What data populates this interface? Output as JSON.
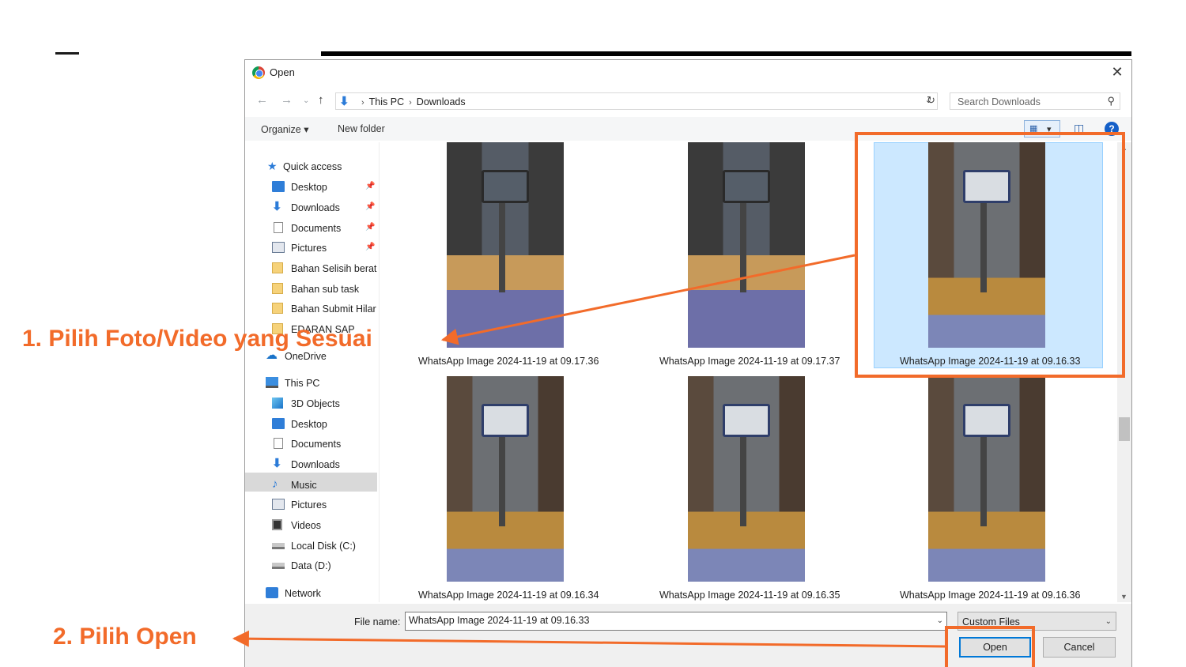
{
  "dialog": {
    "title": "Open",
    "close_symbol": "✕",
    "address": {
      "crumbs": [
        "This PC",
        "Downloads"
      ]
    },
    "search_placeholder": "Search Downloads",
    "toolbar": {
      "organize": "Organize ▾",
      "new_folder": "New folder",
      "help": "?"
    }
  },
  "sidebar": {
    "items": [
      {
        "label": "Quick access",
        "icon": "star-icon"
      },
      {
        "label": "Desktop",
        "icon": "desktop-folder-icon",
        "pinned": true
      },
      {
        "label": "Downloads",
        "icon": "download-arrow-icon",
        "pinned": true
      },
      {
        "label": "Documents",
        "icon": "document-icon",
        "pinned": true
      },
      {
        "label": "Pictures",
        "icon": "pictures-icon",
        "pinned": true
      },
      {
        "label": "Bahan Selisih berat",
        "icon": "folder-icon"
      },
      {
        "label": "Bahan sub task",
        "icon": "folder-icon"
      },
      {
        "label": "Bahan Submit Hilar",
        "icon": "folder-icon"
      },
      {
        "label": "EDARAN SAP",
        "icon": "folder-icon"
      },
      {
        "label": "OneDrive",
        "icon": "cloud-icon"
      },
      {
        "label": "This PC",
        "icon": "computer-icon"
      },
      {
        "label": "3D Objects",
        "icon": "cube-icon"
      },
      {
        "label": "Desktop",
        "icon": "desktop-folder-icon"
      },
      {
        "label": "Documents",
        "icon": "document-icon"
      },
      {
        "label": "Downloads",
        "icon": "download-arrow-icon",
        "selected": true
      },
      {
        "label": "Music",
        "icon": "music-note-icon"
      },
      {
        "label": "Pictures",
        "icon": "pictures-icon"
      },
      {
        "label": "Videos",
        "icon": "video-icon"
      },
      {
        "label": "Local Disk (C:)",
        "icon": "disk-icon"
      },
      {
        "label": "Data (D:)",
        "icon": "disk-icon"
      },
      {
        "label": "Network",
        "icon": "network-icon"
      }
    ]
  },
  "files": [
    {
      "name": "WhatsApp Image 2024-11-19 at 09.17.36"
    },
    {
      "name": "WhatsApp Image 2024-11-19 at 09.17.37"
    },
    {
      "name": "WhatsApp Image 2024-11-19 at 09.16.33",
      "selected": true
    },
    {
      "name": "WhatsApp Image 2024-11-19 at 09.16.34"
    },
    {
      "name": "WhatsApp Image 2024-11-19 at 09.16.35"
    },
    {
      "name": "WhatsApp Image 2024-11-19 at 09.16.36"
    }
  ],
  "footer": {
    "file_name_label": "File name:",
    "file_name_value": "WhatsApp Image 2024-11-19 at 09.16.33",
    "file_type": "Custom Files",
    "open_label": "Open",
    "cancel_label": "Cancel"
  },
  "annotations": {
    "step1": "1.  Pilih Foto/Video yang Sesuai",
    "step2": "2. Pilih Open"
  },
  "colors": {
    "highlight": "#f26b2a",
    "selection": "#cce8ff",
    "accent": "#0078d7"
  }
}
